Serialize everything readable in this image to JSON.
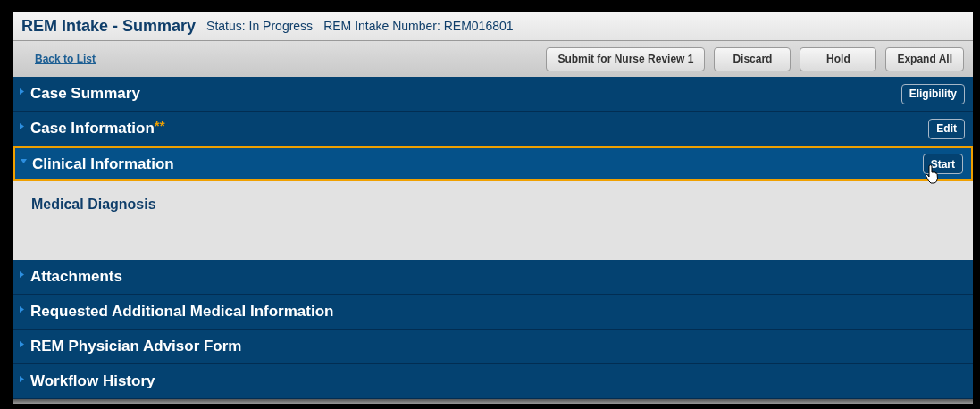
{
  "header": {
    "title": "REM Intake - Summary",
    "status": "Status: In Progress",
    "number": "REM Intake Number: REM016801"
  },
  "toolbar": {
    "back_link": "Back to List",
    "buttons": [
      "Submit for Nurse Review 1",
      "Discard",
      "Hold",
      "Expand All"
    ]
  },
  "sections": [
    {
      "title": "Case Summary",
      "expanded": false,
      "selected": false,
      "button": "Eligibility"
    },
    {
      "title": "Case Information",
      "marker": "**",
      "expanded": false,
      "selected": false,
      "button": "Edit"
    },
    {
      "title": "Clinical Information",
      "expanded": true,
      "selected": true,
      "button": "Start",
      "subsections": [
        "Medical Diagnosis"
      ]
    },
    {
      "title": "Attachments",
      "expanded": false,
      "selected": false
    },
    {
      "title": "Requested Additional Medical Information",
      "expanded": false,
      "selected": false
    },
    {
      "title": "REM Physician Advisor Form",
      "expanded": false,
      "selected": false
    },
    {
      "title": "Workflow History",
      "expanded": false,
      "selected": false
    }
  ]
}
